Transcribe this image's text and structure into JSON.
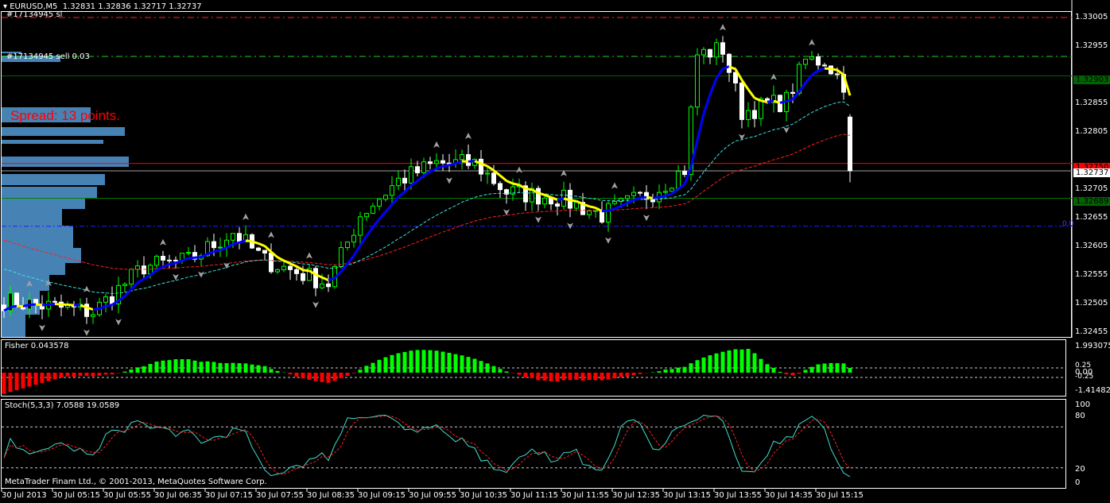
{
  "header": {
    "symbol": "EURUSD,M5",
    "ohlc": "1.32831 1.32836 1.32717 1.32737"
  },
  "orders": {
    "sl_label": "#17134945 sl",
    "sell_label": "#17134945 sell 0.03"
  },
  "spread_text": "Spread: 13 points.",
  "price_axis": [
    "1.33005",
    "1.32955",
    "1.32855",
    "1.32805",
    "1.32705",
    "1.32655",
    "1.32605",
    "1.32555",
    "1.32505",
    "1.32455"
  ],
  "price_tags": {
    "resistance": "1.32903",
    "ask": "1.32750",
    "bid": "1.32737",
    "support": "1.32689",
    "blue_level_label": "0.0"
  },
  "levels": {
    "sl": 1.33005,
    "sell": 1.32937,
    "resistance": 1.32903,
    "ask": 1.3275,
    "bid": 1.32737,
    "support": 1.32689,
    "blue": 1.3264
  },
  "fisher": {
    "label": "Fisher 0.043578",
    "axis": [
      "1.993075",
      "0.25",
      "0.00",
      "-0.25",
      "-1.414827"
    ]
  },
  "stoch": {
    "label": "Stoch(5,3,3) 7.0588 19.0589",
    "axis": [
      "100",
      "80",
      "20",
      "0"
    ]
  },
  "copyright": "MetaTrader Finam Ltd., © 2001-2013, MetaQuotes Software Corp.",
  "time_axis": [
    "30 Jul 2013",
    "30 Jul 05:15",
    "30 Jul 05:55",
    "30 Jul 06:35",
    "30 Jul 07:15",
    "30 Jul 07:55",
    "30 Jul 08:35",
    "30 Jul 09:15",
    "30 Jul 09:55",
    "30 Jul 10:35",
    "30 Jul 11:15",
    "30 Jul 11:55",
    "30 Jul 12:35",
    "30 Jul 13:15",
    "30 Jul 13:55",
    "30 Jul 14:35",
    "30 Jul 15:15"
  ],
  "colors": {
    "bull": "#00ff00",
    "bear": "#ffffff",
    "ma_fast_up": "#0000ff",
    "ma_fast_down": "#ffff00",
    "ma_mid": "#40e0e0",
    "ma_slow": "#ff2020",
    "spread": "#ff0000",
    "profile": "#4682b4"
  },
  "chart_data": {
    "type": "candlestick",
    "timeframe": "M5",
    "close_keypoints": [
      [
        0,
        1.3251
      ],
      [
        7,
        1.325
      ],
      [
        14,
        1.3249
      ],
      [
        22,
        1.3257
      ],
      [
        29,
        1.3258
      ],
      [
        36,
        1.3263
      ],
      [
        41,
        1.3258
      ],
      [
        51,
        1.3254
      ],
      [
        56,
        1.3266
      ],
      [
        62,
        1.3272
      ],
      [
        68,
        1.3275
      ],
      [
        74,
        1.3275
      ],
      [
        79,
        1.327
      ],
      [
        87,
        1.3269
      ],
      [
        94,
        1.3266
      ],
      [
        102,
        1.327
      ],
      [
        107,
        1.3274
      ],
      [
        109,
        1.3294
      ],
      [
        113,
        1.3295
      ],
      [
        116,
        1.3284
      ],
      [
        123,
        1.3286
      ],
      [
        126,
        1.3293
      ],
      [
        129,
        1.3293
      ],
      [
        132,
        1.3289
      ],
      [
        133,
        1.32737
      ]
    ]
  }
}
